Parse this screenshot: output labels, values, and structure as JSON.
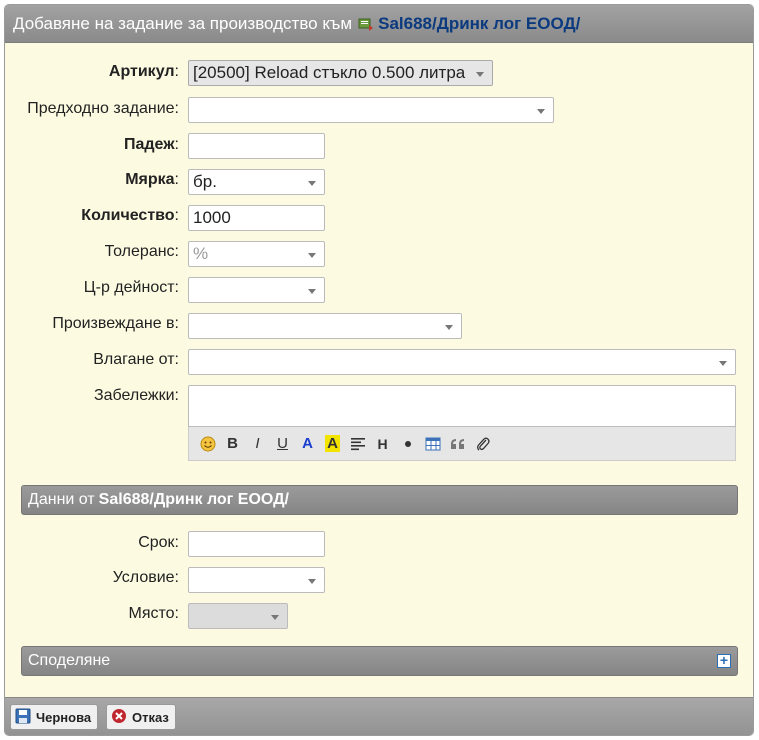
{
  "title": {
    "text": "Добавяне на задание за производство към",
    "company": "Sal688/Дринк лог ЕООД/"
  },
  "form": {
    "article": {
      "label": "Артикул",
      "value": "[20500] Reload стъкло 0.500 литра"
    },
    "previous_task": {
      "label": "Предходно задание",
      "value": ""
    },
    "expiry": {
      "label": "Падеж",
      "value": ""
    },
    "unit": {
      "label": "Мярка",
      "value": "бр."
    },
    "quantity": {
      "label": "Количество",
      "value": "1000"
    },
    "tolerance": {
      "label": "Толеранс",
      "placeholder": "%"
    },
    "activity_center": {
      "label": "Ц-р дейност",
      "value": ""
    },
    "produce_in": {
      "label": "Произвеждане в",
      "value": ""
    },
    "input_from": {
      "label": "Влагане от",
      "value": ""
    },
    "notes": {
      "label": "Забележки",
      "value": ""
    }
  },
  "editor_toolbar": [
    "emoji-icon",
    "bold",
    "italic",
    "underline",
    "text-color",
    "highlight",
    "align",
    "heading",
    "bullet",
    "table",
    "quote",
    "attach"
  ],
  "editor_labels": {
    "bold": "B",
    "italic": "I",
    "underline": "U",
    "color": "A",
    "highlight": "A",
    "heading": "H"
  },
  "section_data": {
    "prefix": "Данни от",
    "company": "Sal688/Дринк лог ЕООД/",
    "deadline": {
      "label": "Срок",
      "value": ""
    },
    "condition": {
      "label": "Условие",
      "value": ""
    },
    "place": {
      "label": "Място",
      "value": ""
    }
  },
  "sharing": {
    "label": "Споделяне"
  },
  "buttons": {
    "draft": "Чернова",
    "cancel": "Отказ"
  },
  "colors": {
    "accent": "#0b3a7f",
    "panel": "#fcfbe2",
    "header": "#939393"
  }
}
